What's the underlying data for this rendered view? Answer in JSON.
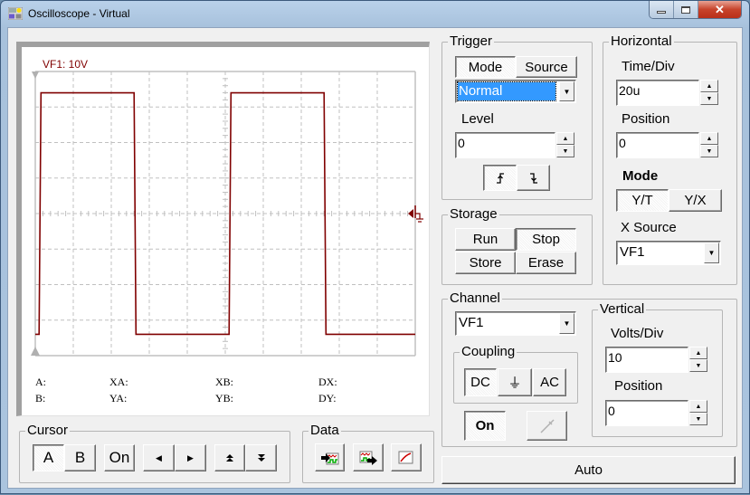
{
  "window": {
    "title": "Oscilloscope - Virtual",
    "controls": {
      "minimize": "minimize",
      "maximize": "maximize",
      "close": "close"
    }
  },
  "scope": {
    "channel_label": "VF1: 10V",
    "trace_color": "#800000",
    "grid_color": "#c0c0c0",
    "readouts": {
      "a": "A:",
      "b": "B:",
      "xa": "XA:",
      "ya": "YA:",
      "xb": "XB:",
      "yb": "YB:",
      "dx": "DX:",
      "dy": "DY:"
    }
  },
  "chart_data": {
    "type": "line",
    "title": "VF1: 10V",
    "xlabel": "",
    "ylabel": "",
    "x_divisions": 10,
    "y_divisions": 8,
    "x_unit_per_div": "20u s",
    "y_unit_per_div": "10 V",
    "xlim": [
      0,
      10
    ],
    "ylim": [
      -4,
      4
    ],
    "grid": true,
    "series": [
      {
        "name": "VF1",
        "x": [
          0.0,
          0.1,
          0.15,
          2.5,
          2.6,
          2.65,
          5.0,
          5.1,
          5.15,
          7.5,
          7.6,
          7.65,
          10.0
        ],
        "y": [
          -3.4,
          -3.4,
          3.4,
          3.4,
          3.4,
          -3.4,
          -3.4,
          -3.4,
          3.4,
          3.4,
          3.4,
          -3.4,
          -3.4
        ]
      }
    ]
  },
  "trigger": {
    "title": "Trigger",
    "tabs": [
      "Mode",
      "Source"
    ],
    "active_tab": "Mode",
    "mode_value": "Normal",
    "level_label": "Level",
    "level_value": "0",
    "rising_edge": "rising-edge",
    "falling_edge": "falling-edge"
  },
  "horizontal": {
    "title": "Horizontal",
    "time_div_label": "Time/Div",
    "time_div_value": "20u",
    "position_label": "Position",
    "position_value": "0",
    "mode_label": "Mode",
    "modes": [
      "Y/T",
      "Y/X"
    ],
    "active_mode": "Y/T",
    "xsource_label": "X Source",
    "xsource_value": "VF1"
  },
  "storage": {
    "title": "Storage",
    "buttons": [
      "Run",
      "Stop",
      "Store",
      "Erase"
    ],
    "active": "Stop"
  },
  "channel": {
    "title": "Channel",
    "value": "VF1",
    "coupling_label": "Coupling",
    "coupling_options": [
      "DC",
      "⏚",
      "AC"
    ],
    "active_coupling": "DC",
    "on_label": "On"
  },
  "vertical": {
    "title": "Vertical",
    "volts_div_label": "Volts/Div",
    "volts_div_value": "10",
    "position_label": "Position",
    "position_value": "0"
  },
  "cursor": {
    "title": "Cursor",
    "a_label": "A",
    "b_label": "B",
    "on_label": "On",
    "active": "A"
  },
  "data": {
    "title": "Data"
  },
  "auto_label": "Auto"
}
